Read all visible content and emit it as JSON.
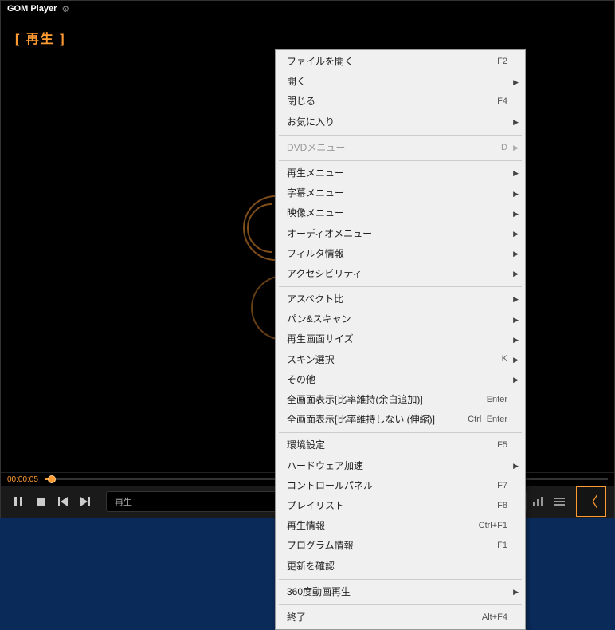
{
  "title_bar": {
    "app_name": "GOM Player",
    "file_name": ""
  },
  "video": {
    "status_text": "[ 再生 ]"
  },
  "seek": {
    "current_time": "00:00:05"
  },
  "controls": {
    "info_text": "再生"
  },
  "menu": {
    "items": [
      {
        "label": "ファイルを開く",
        "shortcut": "F2",
        "sub": false,
        "disabled": false
      },
      {
        "label": "開く",
        "shortcut": "",
        "sub": true,
        "disabled": false
      },
      {
        "label": "閉じる",
        "shortcut": "F4",
        "sub": false,
        "disabled": false
      },
      {
        "label": "お気に入り",
        "shortcut": "",
        "sub": true,
        "disabled": false
      },
      {
        "sep": true
      },
      {
        "label": "DVDメニュー",
        "shortcut": "D",
        "sub": true,
        "disabled": true
      },
      {
        "sep": true
      },
      {
        "label": "再生メニュー",
        "shortcut": "",
        "sub": true,
        "disabled": false
      },
      {
        "label": "字幕メニュー",
        "shortcut": "",
        "sub": true,
        "disabled": false
      },
      {
        "label": "映像メニュー",
        "shortcut": "",
        "sub": true,
        "disabled": false
      },
      {
        "label": "オーディオメニュー",
        "shortcut": "",
        "sub": true,
        "disabled": false
      },
      {
        "label": "フィルタ情報",
        "shortcut": "",
        "sub": true,
        "disabled": false
      },
      {
        "label": "アクセシビリティ",
        "shortcut": "",
        "sub": true,
        "disabled": false
      },
      {
        "sep": true
      },
      {
        "label": "アスペクト比",
        "shortcut": "",
        "sub": true,
        "disabled": false
      },
      {
        "label": "パン&スキャン",
        "shortcut": "",
        "sub": true,
        "disabled": false
      },
      {
        "label": "再生画面サイズ",
        "shortcut": "",
        "sub": true,
        "disabled": false
      },
      {
        "label": "スキン選択",
        "shortcut": "K",
        "sub": true,
        "disabled": false
      },
      {
        "label": "その他",
        "shortcut": "",
        "sub": true,
        "disabled": false
      },
      {
        "label": "全画面表示[比率維持(余白追加)]",
        "shortcut": "Enter",
        "sub": false,
        "disabled": false
      },
      {
        "label": "全画面表示[比率維持しない (伸縮)]",
        "shortcut": "Ctrl+Enter",
        "sub": false,
        "disabled": false
      },
      {
        "sep": true
      },
      {
        "label": "環境設定",
        "shortcut": "F5",
        "sub": false,
        "disabled": false
      },
      {
        "label": "ハードウェア加速",
        "shortcut": "",
        "sub": true,
        "disabled": false
      },
      {
        "label": "コントロールパネル",
        "shortcut": "F7",
        "sub": false,
        "disabled": false
      },
      {
        "label": "プレイリスト",
        "shortcut": "F8",
        "sub": false,
        "disabled": false
      },
      {
        "label": "再生情報",
        "shortcut": "Ctrl+F1",
        "sub": false,
        "disabled": false
      },
      {
        "label": "プログラム情報",
        "shortcut": "F1",
        "sub": false,
        "disabled": false
      },
      {
        "label": "更新を確認",
        "shortcut": "",
        "sub": false,
        "disabled": false
      },
      {
        "sep": true
      },
      {
        "label": "360度動画再生",
        "shortcut": "",
        "sub": true,
        "disabled": false
      },
      {
        "sep": true
      },
      {
        "label": "終了",
        "shortcut": "Alt+F4",
        "sub": false,
        "disabled": false
      }
    ]
  }
}
